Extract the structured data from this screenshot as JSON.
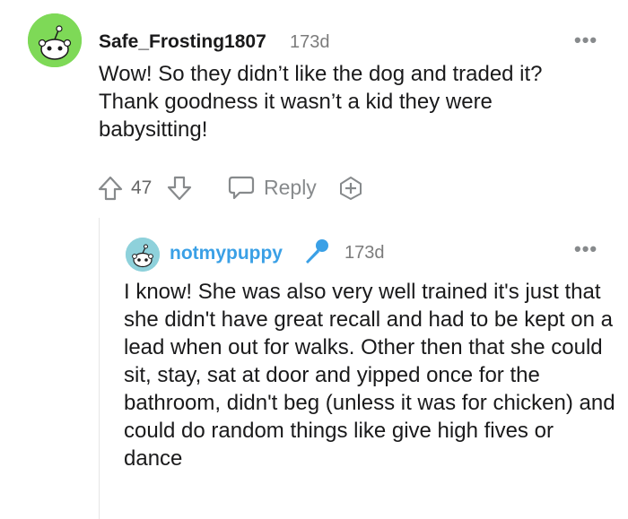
{
  "comment": {
    "username": "Safe_Frosting1807",
    "age": "173d",
    "menu": "•••",
    "body": "Wow! So they didn’t like the dog and traded it? Thank goodness it wasn’t a kid they were babysitting!",
    "avatar_color": "#7ed957",
    "actions": {
      "vote_count": "47",
      "reply_label": "Reply"
    }
  },
  "reply": {
    "username": "notmypuppy",
    "age": "173d",
    "menu": "•••",
    "username_color": "#3aa0e6",
    "avatar_color": "#8ed1db",
    "body": "I know! She was also very well trained it's just that she didn't have great recall and had to be kept on a lead when out for walks. Other then that she could sit, stay, sat at door and yipped once for the bathroom, didn't beg (unless it was for chicken) and could do random things like give high fives or dance"
  },
  "icons": [
    "upvote-icon",
    "downvote-icon",
    "reply-icon",
    "award-icon",
    "microphone-icon",
    "snoo-avatar"
  ]
}
